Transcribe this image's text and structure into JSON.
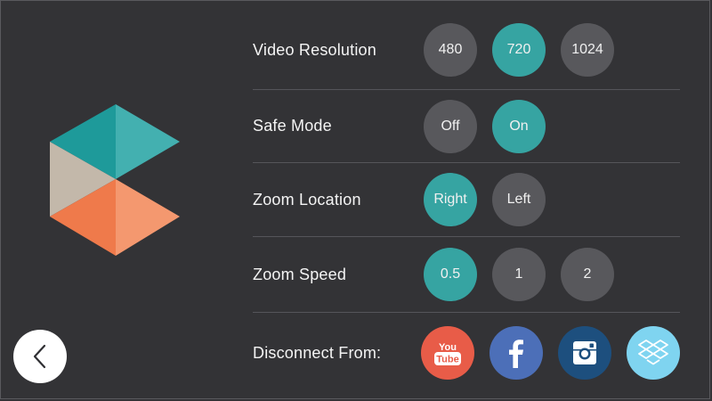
{
  "colors": {
    "background": "#333336",
    "selected": "#36a4a2",
    "unselected": "#58585c",
    "youtube": "#e85c48",
    "facebook": "#4c6fb8",
    "instagram": "#1d4f7e",
    "dropbox": "#7fd4f0"
  },
  "settings": [
    {
      "label": "Video Resolution",
      "options": [
        "480",
        "720",
        "1024"
      ],
      "selected": "720"
    },
    {
      "label": "Safe Mode",
      "options": [
        "Off",
        "On"
      ],
      "selected": "On"
    },
    {
      "label": "Zoom Location",
      "options": [
        "Right",
        "Left"
      ],
      "selected": "Right"
    },
    {
      "label": "Zoom Speed",
      "options": [
        "0.5",
        "1",
        "2"
      ],
      "selected": "0.5"
    }
  ],
  "disconnect": {
    "label": "Disconnect From:",
    "services": [
      {
        "name": "YouTube",
        "icon": "youtube-icon",
        "logo_text_top": "You",
        "logo_text_bottom": "Tube"
      },
      {
        "name": "Facebook",
        "icon": "facebook-icon"
      },
      {
        "name": "Instagram",
        "icon": "instagram-icon"
      },
      {
        "name": "Dropbox",
        "icon": "dropbox-icon"
      }
    ]
  },
  "back_icon": "chevron-left-icon"
}
